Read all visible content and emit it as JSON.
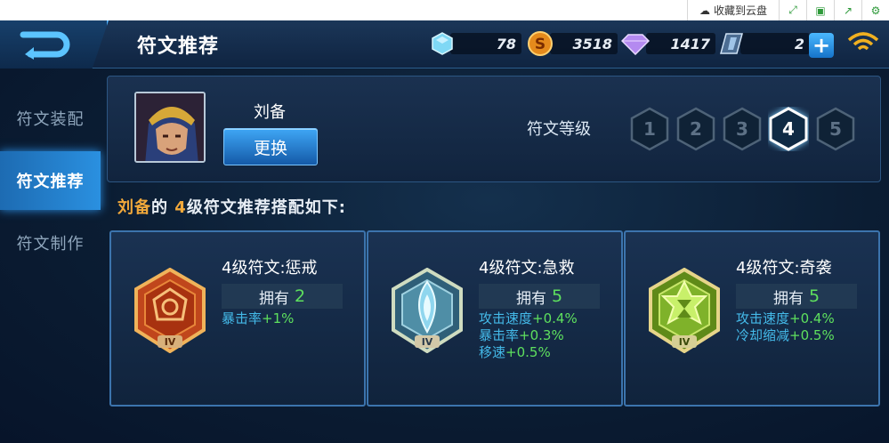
{
  "browser": {
    "save_to_cloud": "收藏到云盘"
  },
  "header": {
    "title": "符文推荐"
  },
  "currency": {
    "crystal": "78",
    "gold": "3518",
    "diamond": "1417",
    "ticket": "2"
  },
  "sidebar": {
    "items": [
      {
        "label": "符文装配"
      },
      {
        "label": "符文推荐"
      },
      {
        "label": "符文制作"
      }
    ]
  },
  "hero": {
    "name": "刘备",
    "swap_label": "更换",
    "level_label": "符文等级",
    "levels": [
      "1",
      "2",
      "3",
      "4",
      "5"
    ],
    "selected_level": 4
  },
  "headline": {
    "hero": "刘备",
    "de": "的 ",
    "level": "4",
    "rest": "级符文推荐搭配如下:"
  },
  "runes": [
    {
      "name": "4级符文:惩戒",
      "own_label": "拥有",
      "count": "2",
      "icon": "red-rune-icon",
      "attrs": [
        {
          "k": "暴击率",
          "v": "+1%"
        }
      ]
    },
    {
      "name": "4级符文:急救",
      "own_label": "拥有",
      "count": "5",
      "icon": "blue-rune-icon",
      "attrs": [
        {
          "k": "攻击速度",
          "v": "+0.4%"
        },
        {
          "k": "暴击率",
          "v": "+0.3%"
        },
        {
          "k": "移速",
          "v": "+0.5%"
        }
      ]
    },
    {
      "name": "4级符文:奇袭",
      "own_label": "拥有",
      "count": "5",
      "icon": "green-rune-icon",
      "attrs": [
        {
          "k": "攻击速度",
          "v": "+0.4%"
        },
        {
          "k": "冷却缩减",
          "v": "+0.5%"
        }
      ]
    }
  ],
  "rune_tier": "IV",
  "colors": {
    "accent": "#2a90e0",
    "highlight": "#f2a93b",
    "stat": "#44b9e8",
    "value": "#5ee05e"
  }
}
